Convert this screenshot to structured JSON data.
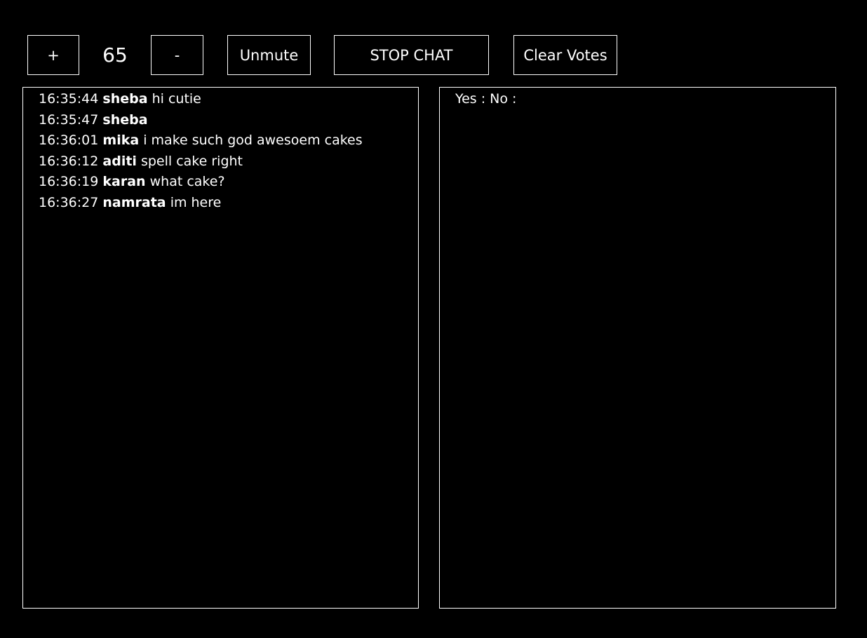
{
  "toolbar": {
    "plus_label": "+",
    "counter_value": "65",
    "minus_label": "-",
    "unmute_label": "Unmute",
    "stop_chat_label": "STOP CHAT",
    "clear_votes_label": "Clear Votes"
  },
  "chat": {
    "messages": [
      {
        "time": "16:35:44",
        "user": "sheba",
        "text": "hi cutie"
      },
      {
        "time": "16:35:47",
        "user": "sheba",
        "text": ""
      },
      {
        "time": "16:36:01",
        "user": "mika",
        "text": "i make such god awesoem cakes"
      },
      {
        "time": "16:36:12",
        "user": "aditi",
        "text": "spell cake right"
      },
      {
        "time": "16:36:19",
        "user": "karan",
        "text": "what cake?"
      },
      {
        "time": "16:36:27",
        "user": "namrata",
        "text": "im here"
      }
    ]
  },
  "votes": {
    "summary": "Yes : No :"
  },
  "colors": {
    "background": "#000000",
    "foreground": "#ffffff"
  }
}
